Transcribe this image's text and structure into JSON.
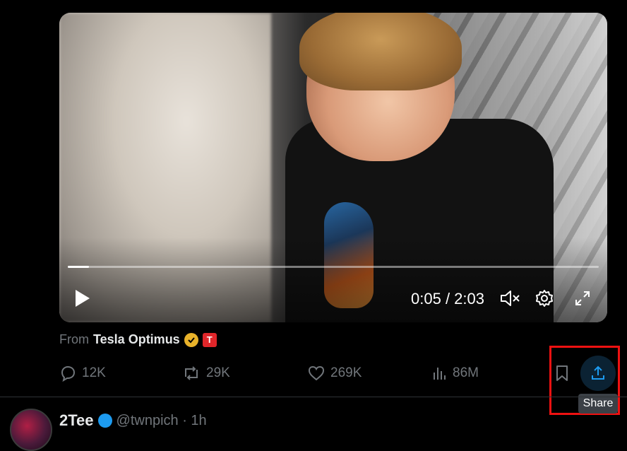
{
  "video": {
    "time": "0:05 / 2:03",
    "progress_fraction": 0.04
  },
  "from": {
    "prefix": "From",
    "name": "Tesla Optimus",
    "badge_letter": "T"
  },
  "actions": {
    "reply_count": "12K",
    "repost_count": "29K",
    "like_count": "269K",
    "views_count": "86M"
  },
  "tooltip": {
    "share": "Share"
  },
  "next_post": {
    "name": "2Tee",
    "handle": "@twnpich · 1h"
  },
  "colors": {
    "accent": "#1d9bf0",
    "highlight_box": "#ee1111",
    "muted_text": "#71767b",
    "verified_gold": "#e8b22a",
    "tesla_red": "#e0262a"
  },
  "icons": [
    "play-icon",
    "mute-icon",
    "settings-gear-icon",
    "fullscreen-icon",
    "reply-icon",
    "repost-icon",
    "like-heart-icon",
    "views-chart-icon",
    "bookmark-icon",
    "share-icon",
    "verified-gold-icon",
    "tesla-logo-icon",
    "verified-blue-icon"
  ]
}
